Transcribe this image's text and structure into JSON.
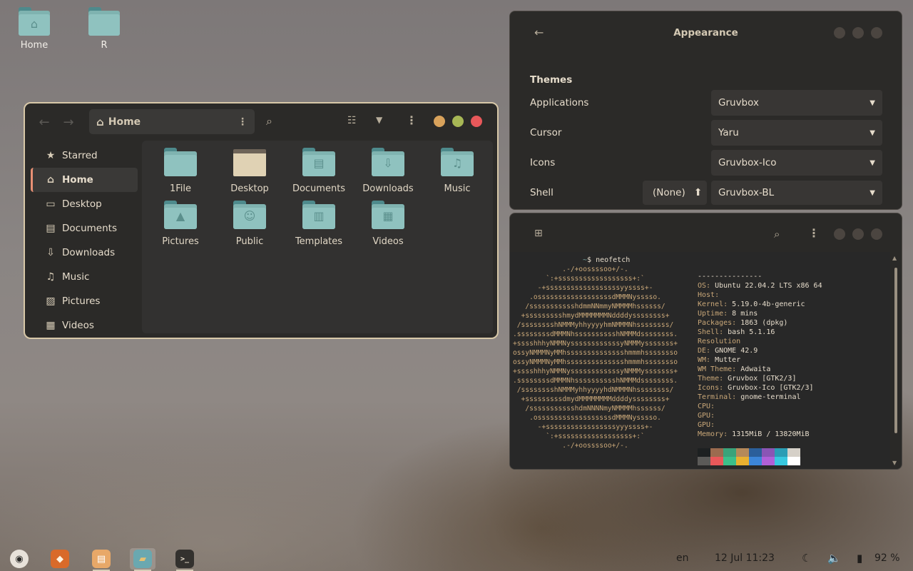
{
  "desktop": {
    "icons": [
      {
        "label": "Home"
      },
      {
        "label": "R"
      }
    ]
  },
  "file_manager": {
    "path_label": "Home",
    "sidebar": [
      {
        "label": "Starred",
        "icon": "star-icon"
      },
      {
        "label": "Home",
        "icon": "home-icon",
        "active": true
      },
      {
        "label": "Desktop",
        "icon": "desktop-icon"
      },
      {
        "label": "Documents",
        "icon": "document-icon"
      },
      {
        "label": "Downloads",
        "icon": "download-icon"
      },
      {
        "label": "Music",
        "icon": "music-icon"
      },
      {
        "label": "Pictures",
        "icon": "pictures-icon"
      },
      {
        "label": "Videos",
        "icon": "video-icon"
      }
    ],
    "folders": [
      {
        "label": "1File"
      },
      {
        "label": "Desktop"
      },
      {
        "label": "Documents"
      },
      {
        "label": "Downloads"
      },
      {
        "label": "Music"
      },
      {
        "label": "Pictures"
      },
      {
        "label": "Public"
      },
      {
        "label": "Templates"
      },
      {
        "label": "Videos"
      }
    ],
    "window_colors": {
      "minimize": "#d9a25b",
      "maximize": "#a7b755",
      "close": "#e8585a"
    }
  },
  "appearance": {
    "title": "Appearance",
    "section": "Themes",
    "rows": [
      {
        "label": "Applications",
        "value": "Gruvbox"
      },
      {
        "label": "Cursor",
        "value": "Yaru"
      },
      {
        "label": "Icons",
        "value": "Gruvbox-Ico"
      },
      {
        "label": "Shell",
        "value": "Gruvbox-BL"
      }
    ],
    "shell_none_button": "(None)"
  },
  "terminal": {
    "prompt": "$ neofetch",
    "prompt_tilde": "~",
    "logo": [
      "            .-/+oossssoo+/-.",
      "        `:+ssssssssssssssssss+:`",
      "      -+ssssssssssssssssssyyssss+-",
      "    .ossssssssssssssssssdMMMNysssso.",
      "   /ssssssssssshdmmNNmmyNMMMMhssssss/",
      "  +ssssssssshmydMMMMMMMNddddyssssssss+",
      " /sssssssshNMMMyhhyyyyhmNMMMNhssssssss/",
      ".ssssssssdMMMNhsssssssssshNMMMdssssssss.",
      "+sssshhhyNMMNyssssssssssssyNMMMysssssss+",
      "ossyNMMMNyMMhsssssssssssssshmmmhssssssso",
      "ossyNMMMNyMMhsssssssssssssshmmmhssssssso",
      "+sssshhhyNMMNyssssssssssssyNMMMysssssss+",
      ".ssssssssdMMMNhsssssssssshNMMMdssssssss.",
      " /sssssssshNMMMyhhyyyyhdNMMMNhssssssss/",
      "  +sssssssssdmydMMMMMMMMddddyssssssss+",
      "   /ssssssssssshdmNNNNmyNMMMMhssssss/",
      "    .ossssssssssssssssssdMMMNysssso.",
      "      -+sssssssssssssssssyyyssss+-",
      "        `:+ssssssssssssssssss+:`",
      "            .-/+oossssoo+/-."
    ],
    "info": [
      {
        "key": "",
        "value": "---------------"
      },
      {
        "key": "OS:",
        "value": " Ubuntu 22.04.2 LTS x86 64"
      },
      {
        "key": "Host:",
        "value": ""
      },
      {
        "key": "Kernel:",
        "value": " 5.19.0-4b-generic"
      },
      {
        "key": "Uptime:",
        "value": " 8 mins"
      },
      {
        "key": "Packages:",
        "value": " 1863 (dpkg)"
      },
      {
        "key": "Shell:",
        "value": " bash 5.1.16"
      },
      {
        "key": "Resolution",
        "value": ""
      },
      {
        "key": "DE:",
        "value": " GNOME 42.9"
      },
      {
        "key": "WM:",
        "value": " Mutter"
      },
      {
        "key": "WM Theme:",
        "value": " Adwaita"
      },
      {
        "key": "Theme:",
        "value": " Gruvbox [GTK2/3]"
      },
      {
        "key": "Icons:",
        "value": " Gruvbox-Ico [GTK2/3]"
      },
      {
        "key": "Terminal:",
        "value": " gnome-terminal"
      },
      {
        "key": "CPU:",
        "value": ""
      },
      {
        "key": "GPU:",
        "value": ""
      },
      {
        "key": "GPU:",
        "value": ""
      },
      {
        "key": "Memory:",
        "value": " 1315MiB / 13820MiB"
      }
    ],
    "palette_top": [
      "#1d2021",
      "#9b6b4f",
      "#3aa37a",
      "#b5895a",
      "#2b5f9a",
      "#8a55b5",
      "#2a9db5",
      "#d5d0c8"
    ],
    "palette_bottom": [
      "#5b5a58",
      "#e8585a",
      "#3cbf8a",
      "#e8b030",
      "#3c86d8",
      "#b060d8",
      "#38c8e0",
      "#ffffff"
    ]
  },
  "taskbar": {
    "apps": [
      {
        "name": "avatar-app",
        "color": "#e8e2da",
        "glyph": "◉"
      },
      {
        "name": "firefox-app",
        "color": "#d96a2a",
        "glyph": "◆"
      },
      {
        "name": "settings-app",
        "color": "#e8a868",
        "glyph": "▤"
      },
      {
        "name": "files-app",
        "color": "#6aa8b0",
        "glyph": "▰"
      },
      {
        "name": "terminal-app",
        "color": "#33312e",
        "glyph": ">_"
      }
    ],
    "language": "en",
    "clock": "12 Jul 11:23",
    "battery": "92 %"
  }
}
